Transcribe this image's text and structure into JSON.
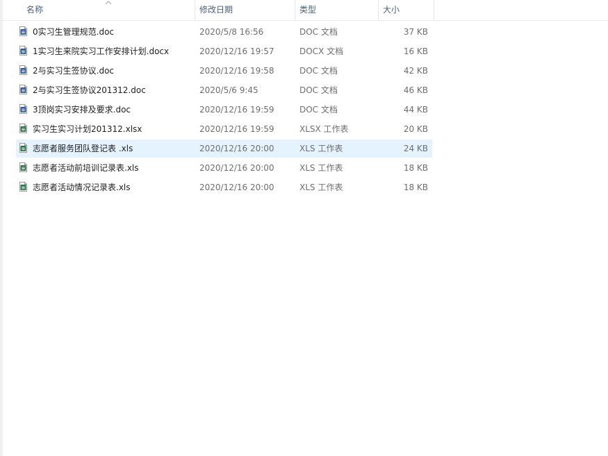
{
  "columns": {
    "name": "名称",
    "modified": "修改日期",
    "type": "类型",
    "size": "大小"
  },
  "colors": {
    "word_icon": "#2b579a",
    "excel_icon": "#217346",
    "selection": "#e5f3ff",
    "header_text": "#4c607a"
  },
  "files": [
    {
      "name": "0实习生管理规范.doc",
      "modified": "2020/5/8 16:56",
      "type": "DOC 文档",
      "size": "37 KB",
      "icon": "word-doc-icon",
      "selected": false
    },
    {
      "name": "1实习生来院实习工作安排计划.docx",
      "modified": "2020/12/16 19:57",
      "type": "DOCX 文档",
      "size": "16 KB",
      "icon": "word-docx-icon",
      "selected": false
    },
    {
      "name": "2与实习生签协议.doc",
      "modified": "2020/12/16 19:58",
      "type": "DOC 文档",
      "size": "42 KB",
      "icon": "word-doc-icon",
      "selected": false
    },
    {
      "name": "2与实习生签协议201312.doc",
      "modified": "2020/5/6 9:45",
      "type": "DOC 文档",
      "size": "46 KB",
      "icon": "word-doc-icon",
      "selected": false
    },
    {
      "name": "3顶岗实习安排及要求.doc",
      "modified": "2020/12/16 19:59",
      "type": "DOC 文档",
      "size": "44 KB",
      "icon": "word-doc-icon",
      "selected": false
    },
    {
      "name": "实习生实习计划201312.xlsx",
      "modified": "2020/12/16 19:59",
      "type": "XLSX 工作表",
      "size": "20 KB",
      "icon": "excel-xlsx-icon",
      "selected": false
    },
    {
      "name": "志愿者服务团队登记表 .xls",
      "modified": "2020/12/16 20:00",
      "type": "XLS 工作表",
      "size": "24 KB",
      "icon": "excel-xls-icon",
      "selected": true
    },
    {
      "name": "志愿者活动前培训记录表.xls",
      "modified": "2020/12/16 20:00",
      "type": "XLS 工作表",
      "size": "18 KB",
      "icon": "excel-xls-icon",
      "selected": false
    },
    {
      "name": "志愿者活动情况记录表.xls",
      "modified": "2020/12/16 20:00",
      "type": "XLS 工作表",
      "size": "18 KB",
      "icon": "excel-xls-icon",
      "selected": false
    }
  ]
}
